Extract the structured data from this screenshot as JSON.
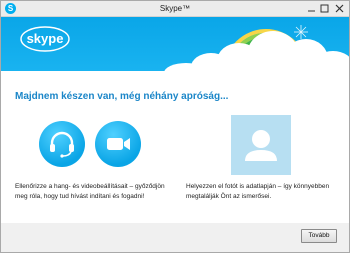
{
  "window": {
    "title": "Skype™"
  },
  "banner": {
    "logo_text": "skype",
    "brand_color": "#00aff0"
  },
  "main": {
    "heading": "Majdnem készen van, még néhány apróság...",
    "features": [
      {
        "icon": "headset-icon",
        "description": "Ellenőrizze a hang- és videobeállításait – győződjön meg róla, hogy tud hívást indítani és fogadni!"
      },
      {
        "icon": "video-camera-icon"
      },
      {
        "icon": "profile-picture-icon",
        "description": "Helyezzen el fotót is adatlapján – így könnyebben megtalálják Önt az ismerősei."
      }
    ]
  },
  "footer": {
    "next_label": "Tovább"
  }
}
